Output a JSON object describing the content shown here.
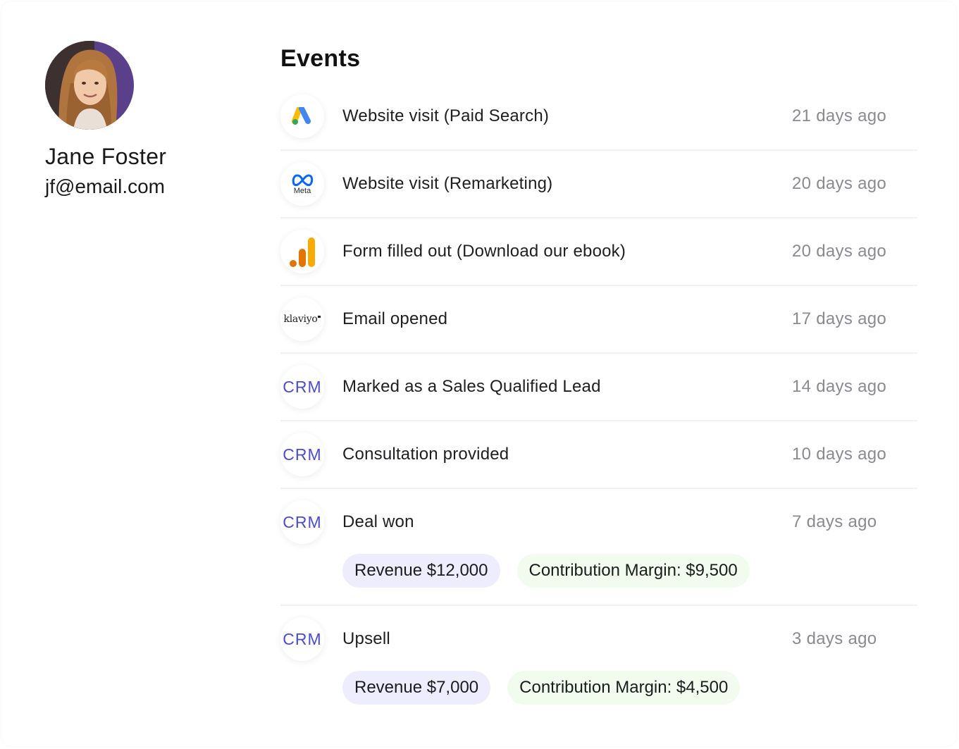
{
  "profile": {
    "name": "Jane Foster",
    "email": "jf@email.com"
  },
  "events_title": "Events",
  "events": [
    {
      "icon": "google-ads-icon",
      "label": "Website visit (Paid Search)",
      "time": "21 days ago"
    },
    {
      "icon": "meta-icon",
      "icon_text": "Meta",
      "label": "Website visit (Remarketing)",
      "time": "20 days ago"
    },
    {
      "icon": "google-analytics-icon",
      "label": "Form filled out (Download our ebook)",
      "time": "20 days ago"
    },
    {
      "icon": "klaviyo-icon",
      "icon_text": "klaviyo",
      "label": "Email opened",
      "time": "17 days ago"
    },
    {
      "icon": "crm-icon",
      "icon_text": "CRM",
      "label": "Marked as a Sales Qualified Lead",
      "time": "14 days ago"
    },
    {
      "icon": "crm-icon",
      "icon_text": "CRM",
      "label": "Consultation provided",
      "time": "10 days ago"
    },
    {
      "icon": "crm-icon",
      "icon_text": "CRM",
      "label": "Deal won",
      "time": "7 days ago",
      "revenue": "Revenue $12,000",
      "margin": "Contribution Margin: $9,500"
    },
    {
      "icon": "crm-icon",
      "icon_text": "CRM",
      "label": "Upsell",
      "time": "3 days ago",
      "revenue": "Revenue $7,000",
      "margin": "Contribution Margin: $4,500"
    }
  ],
  "colors": {
    "crm_accent": "#4b4bd6",
    "revenue_pill": "#ededfd",
    "margin_pill": "#f1fcee",
    "time_text": "#8a8a90"
  }
}
